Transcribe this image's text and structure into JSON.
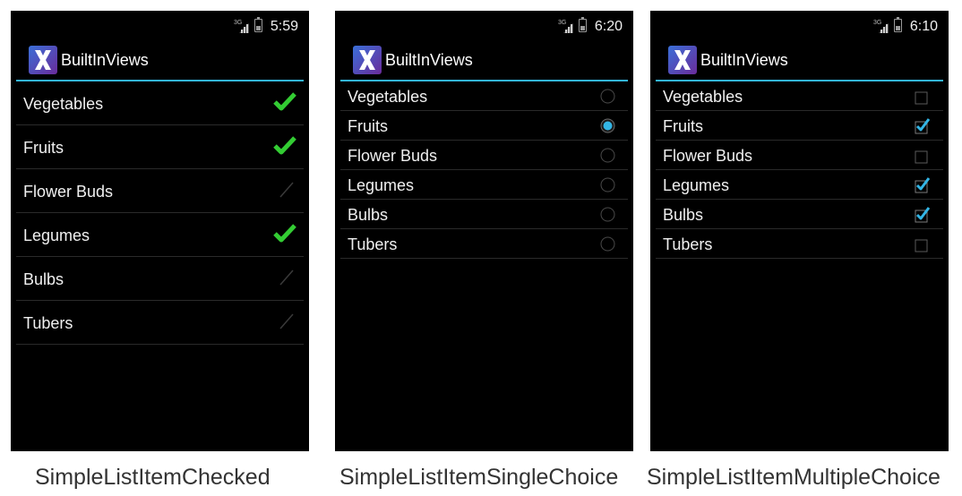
{
  "colors": {
    "background": "#000000",
    "accent": "#33b5e5",
    "check_green": "#33cc33",
    "label": "#f0f0f0",
    "divider": "#2a2a2a"
  },
  "screens": [
    {
      "status": {
        "time": "5:59",
        "network": "3G",
        "signal_icon": "cellular-signal-icon",
        "battery_icon": "battery-icon"
      },
      "app": {
        "title": "BuiltInViews",
        "icon": "xamarin-logo-icon"
      },
      "mode": "checked",
      "items": [
        {
          "label": "Vegetables",
          "checked": true
        },
        {
          "label": "Fruits",
          "checked": true
        },
        {
          "label": "Flower Buds",
          "checked": false
        },
        {
          "label": "Legumes",
          "checked": true
        },
        {
          "label": "Bulbs",
          "checked": false
        },
        {
          "label": "Tubers",
          "checked": false
        }
      ],
      "caption": "SimpleListItemChecked"
    },
    {
      "status": {
        "time": "6:20",
        "network": "3G",
        "signal_icon": "cellular-signal-icon",
        "battery_icon": "battery-icon"
      },
      "app": {
        "title": "BuiltInViews",
        "icon": "xamarin-logo-icon"
      },
      "mode": "single",
      "items": [
        {
          "label": "Vegetables",
          "checked": false
        },
        {
          "label": "Fruits",
          "checked": true
        },
        {
          "label": "Flower Buds",
          "checked": false
        },
        {
          "label": "Legumes",
          "checked": false
        },
        {
          "label": "Bulbs",
          "checked": false
        },
        {
          "label": "Tubers",
          "checked": false
        }
      ],
      "caption": "SimpleListItemSingleChoice"
    },
    {
      "status": {
        "time": "6:10",
        "network": "3G",
        "signal_icon": "cellular-signal-icon",
        "battery_icon": "battery-icon"
      },
      "app": {
        "title": "BuiltInViews",
        "icon": "xamarin-logo-icon"
      },
      "mode": "multiple",
      "items": [
        {
          "label": "Vegetables",
          "checked": false
        },
        {
          "label": "Fruits",
          "checked": true
        },
        {
          "label": "Flower Buds",
          "checked": false
        },
        {
          "label": "Legumes",
          "checked": true
        },
        {
          "label": "Bulbs",
          "checked": true
        },
        {
          "label": "Tubers",
          "checked": false
        }
      ],
      "caption": "SimpleListItemMultipleChoice"
    }
  ]
}
